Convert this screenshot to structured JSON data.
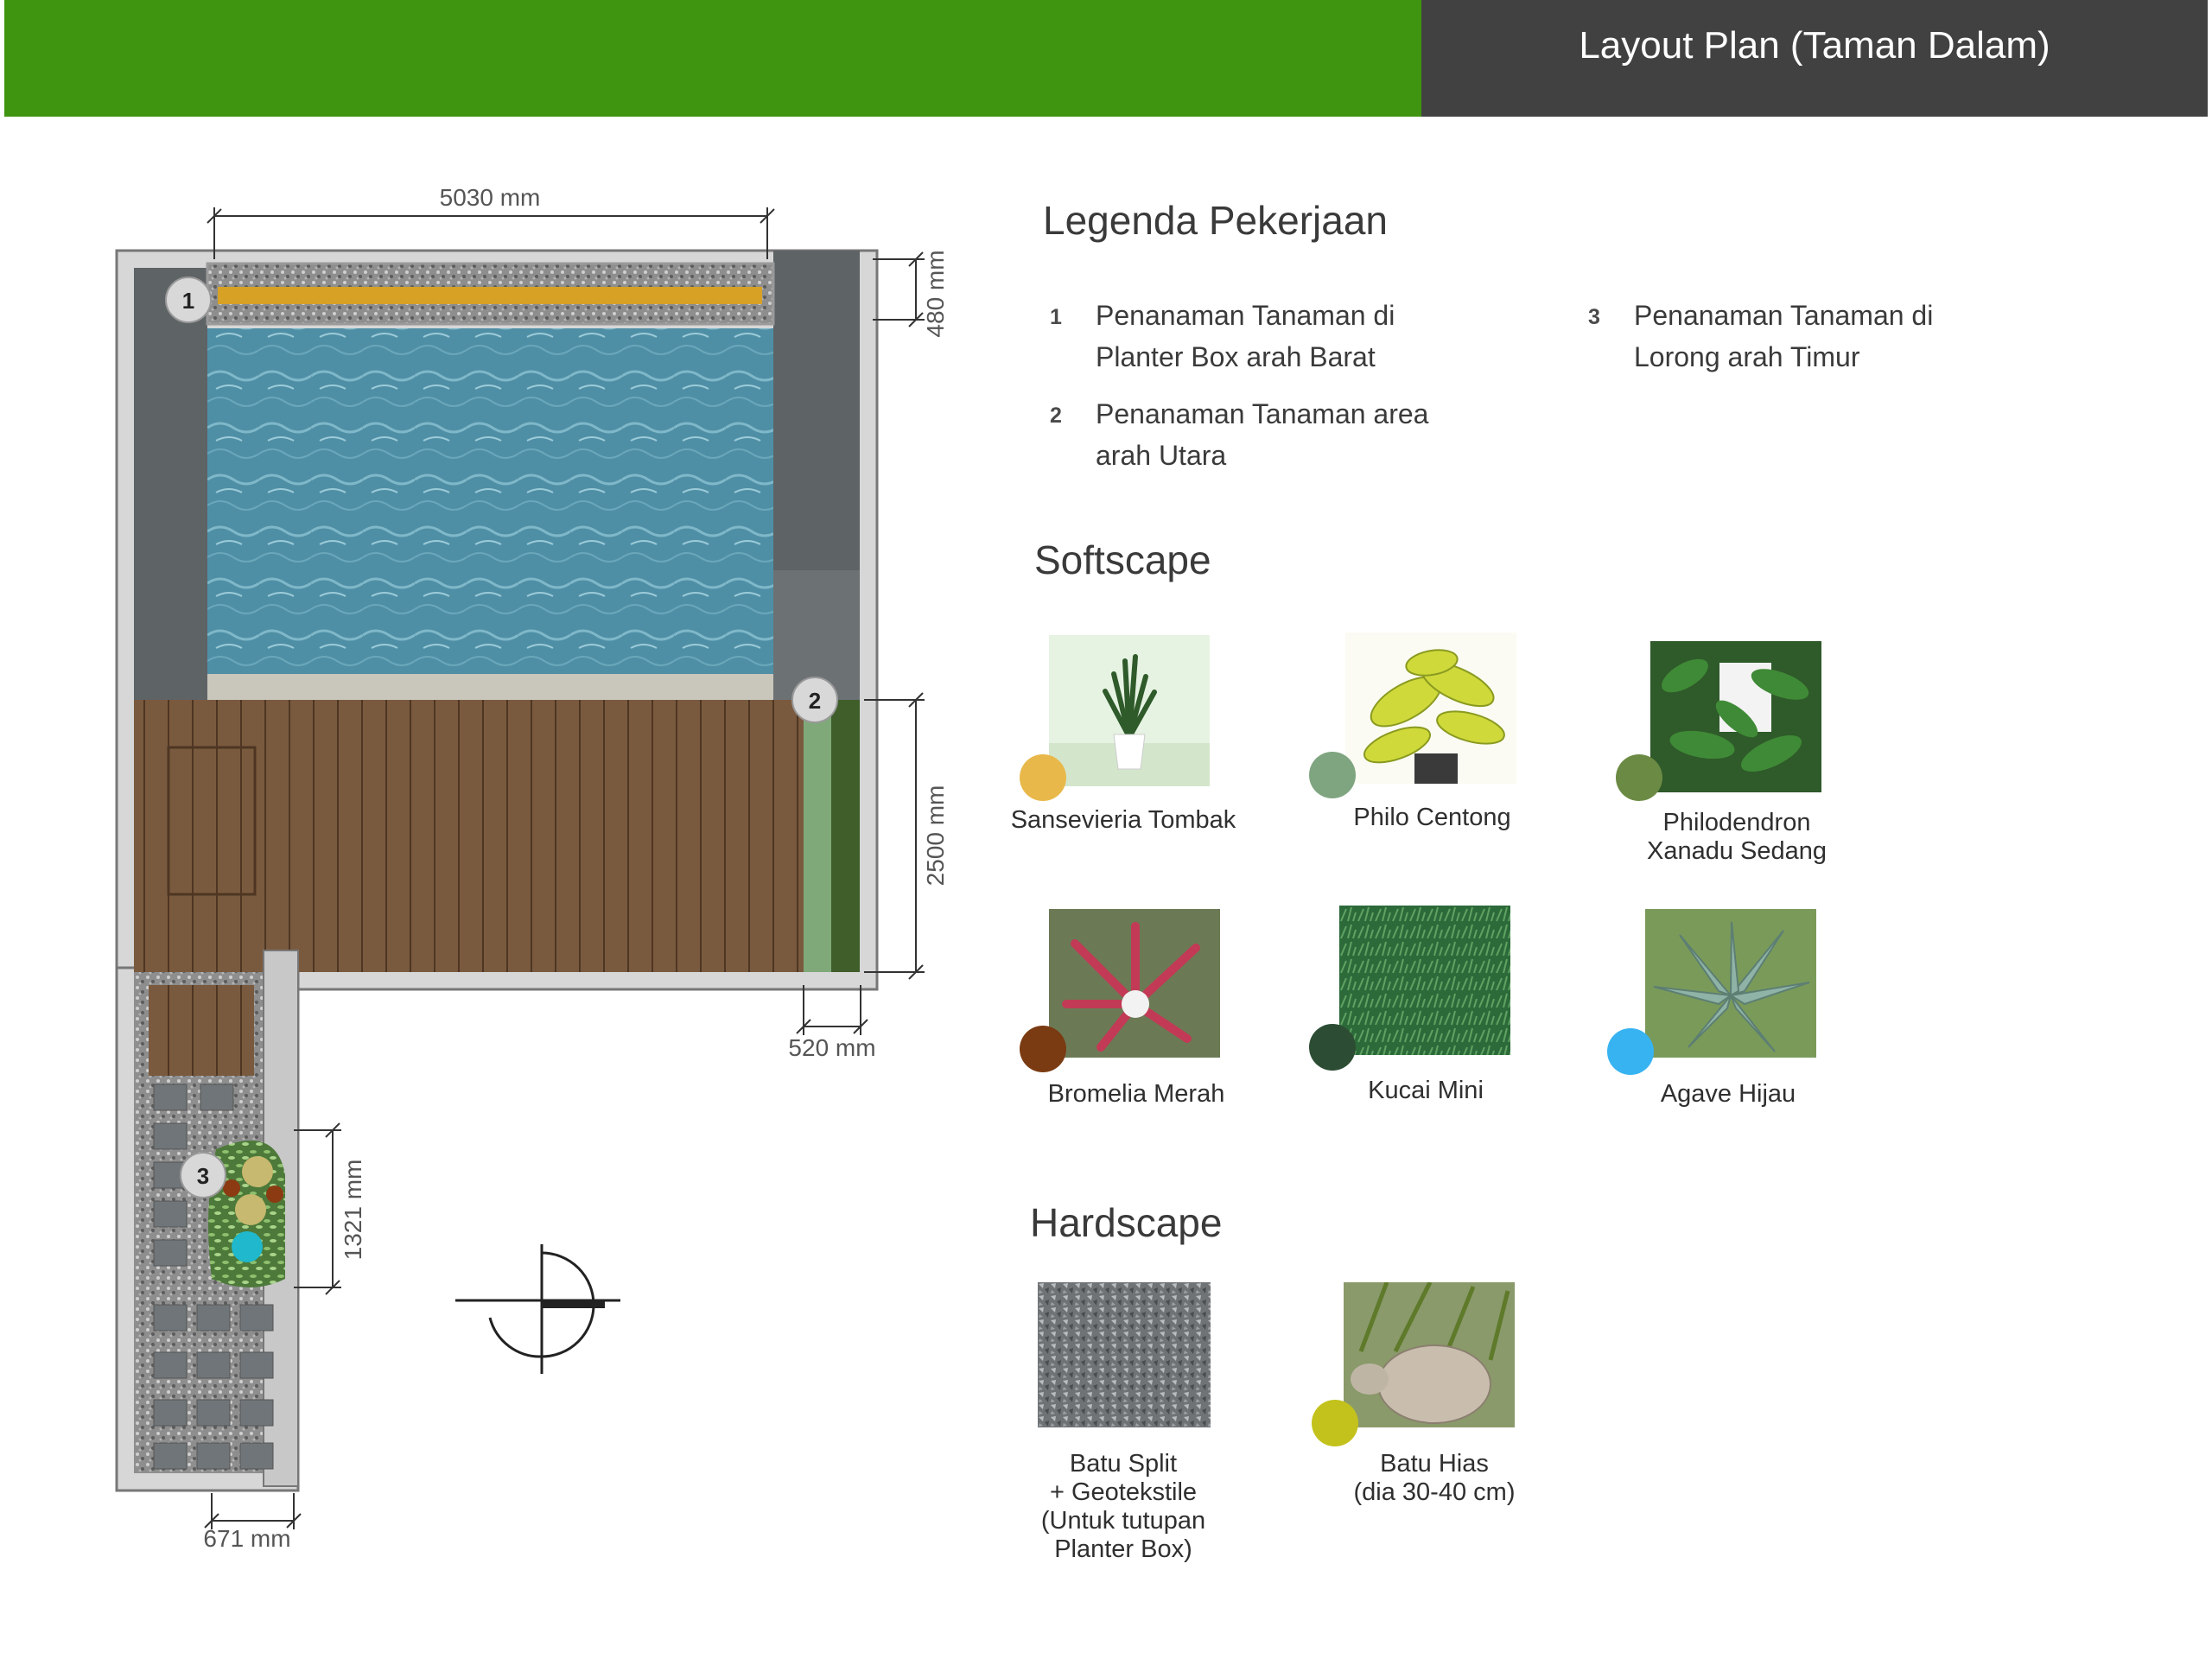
{
  "header": {
    "title": "Layout Plan (Taman Dalam)"
  },
  "plan": {
    "dimensions": {
      "top_width": "5030 mm",
      "planter_depth": "480 mm",
      "deck_length": "2500 mm",
      "side_bed_width": "520 mm",
      "corridor_bed_length": "1321 mm",
      "corridor_width": "671 mm"
    },
    "markers": [
      "1",
      "2",
      "3"
    ]
  },
  "legend": {
    "title": "Legenda Pekerjaan",
    "items": [
      {
        "num": "1",
        "line1": "Penanaman Tanaman di",
        "line2": "Planter Box arah Barat"
      },
      {
        "num": "2",
        "line1": "Penanaman Tanaman area",
        "line2": "arah Utara"
      },
      {
        "num": "3",
        "line1": "Penanaman Tanaman di",
        "line2": "Lorong arah Timur"
      }
    ]
  },
  "softscape": {
    "title": "Softscape",
    "plants": [
      {
        "name": "Sansevieria Tombak",
        "color": "#e8b84a"
      },
      {
        "name": "Philo Centong",
        "color": "#7fa580"
      },
      {
        "name": "Philodendron\nXanadu Sedang",
        "color": "#6b8a43"
      },
      {
        "name": "Bromelia Merah",
        "color": "#7a3b12"
      },
      {
        "name": "Kucai Mini",
        "color": "#2c4d33"
      },
      {
        "name": "Agave Hijau",
        "color": "#38b3f2"
      }
    ]
  },
  "hardscape": {
    "title": "Hardscape",
    "items": [
      {
        "name": "Batu Split\n+ Geotekstile\n(Untuk tutupan\nPlanter Box)"
      },
      {
        "name": "Batu Hias\n(dia 30-40 cm)",
        "color": "#c3c21d"
      }
    ]
  }
}
